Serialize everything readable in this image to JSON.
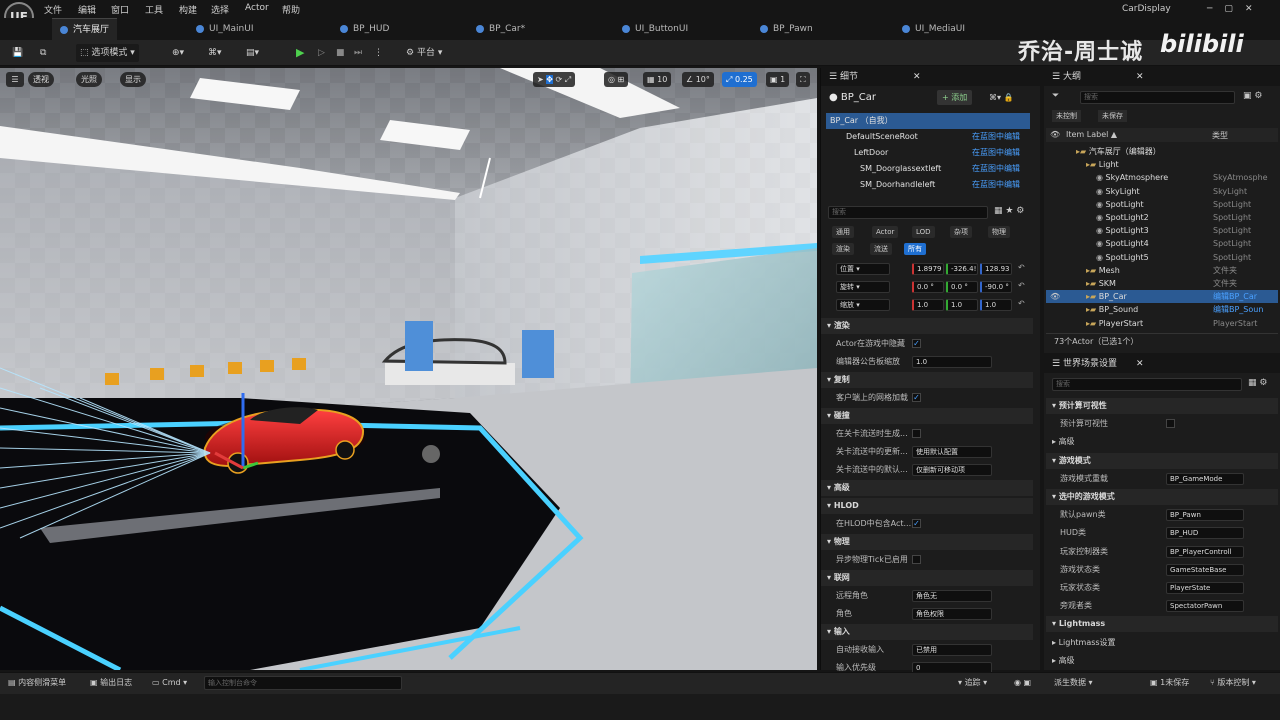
{
  "app": {
    "logo": "UE",
    "project": "CarDisplay"
  },
  "menu": [
    "文件",
    "编辑",
    "窗口",
    "工具",
    "构建",
    "选择",
    "Actor",
    "帮助"
  ],
  "tabs": [
    {
      "label": "汽车展厅",
      "active": true
    },
    {
      "label": "UI_MainUI"
    },
    {
      "label": "BP_HUD"
    },
    {
      "label": "BP_Car*"
    },
    {
      "label": "UI_ButtonUI"
    },
    {
      "label": "BP_Pawn"
    },
    {
      "label": "UI_MediaUI"
    }
  ],
  "window_controls": [
    "─",
    "▢",
    "✕"
  ],
  "watermark": {
    "name": "乔治-周士诚",
    "brand": "bilibili"
  },
  "toolbar": {
    "mode": "选项模式",
    "platform": "平台",
    "play": "▶",
    "step": "▷",
    "stop": "■",
    "skip": "⏭"
  },
  "viewport": {
    "perspective": "透视",
    "lit": "光照",
    "show": "显示",
    "grid": "10",
    "angle": "10°",
    "scale": "0.25",
    "cams": "1"
  },
  "details": {
    "title": "细节",
    "actor": "BP_Car",
    "add": "+ 添加",
    "tree": [
      {
        "label": "BP_Car （自我）",
        "sel": true
      },
      {
        "label": "DefaultSceneRoot",
        "link": "在蓝图中编辑"
      },
      {
        "label": "LeftDoor",
        "link": "在蓝图中编辑"
      },
      {
        "label": "SM_Doorglassextleft",
        "link": "在蓝图中编辑"
      },
      {
        "label": "SM_Doorhandleleft",
        "link": "在蓝图中编辑"
      }
    ],
    "search_placeholder": "搜索",
    "filters": [
      "通用",
      "Actor",
      "LOD",
      "杂项",
      "物理",
      "渲染",
      "流送",
      "所有"
    ],
    "transform": [
      {
        "label": "位置",
        "v": [
          "1.8979",
          "-326.4!",
          "128.93"
        ]
      },
      {
        "label": "旋转",
        "v": [
          "0.0 °",
          "0.0 °",
          "-90.0 °"
        ]
      },
      {
        "label": "缩放",
        "v": [
          "1.0",
          "1.0",
          "1.0"
        ]
      }
    ],
    "sections": {
      "render": "渲染",
      "hidden": "Actor在游戏中隐藏",
      "billboard": "编辑器公告板缩放",
      "billboard_v": "1.0",
      "replication": "复制",
      "net_load": "客户端上的网格加载",
      "collision": "碰撞",
      "gen": "在关卡流送时生成...",
      "update": "关卡流送中的更新...",
      "update_v": "使用默认配置",
      "default": "关卡流送中的默认...",
      "default_v": "仅删新可移动项",
      "advanced": "高级",
      "hlod": "HLOD",
      "hlod_inc": "在HLOD中包含Act...",
      "physics": "物理",
      "async": "异步物理Tick已启用",
      "network": "联网",
      "remote": "远程角色",
      "remote_v": "角色无",
      "role": "角色",
      "role_v": "角色权限",
      "input": "输入",
      "auto": "自动接收输入",
      "auto_v": "已禁用",
      "priority": "输入优先级",
      "priority_v": "0"
    }
  },
  "outliner": {
    "title": "大纲",
    "search_placeholder": "搜索",
    "unsaved": "未控制",
    "unsaved2": "未保存",
    "col1": "Item Label ▲",
    "col2": "类型",
    "items": [
      {
        "l": "汽车展厅（编辑器）",
        "t": "",
        "d": 1
      },
      {
        "l": "Light",
        "t": "",
        "d": 2
      },
      {
        "l": "SkyAtmosphere",
        "t": "SkyAtmosphe",
        "d": 3
      },
      {
        "l": "SkyLight",
        "t": "SkyLight",
        "d": 3
      },
      {
        "l": "SpotLight",
        "t": "SpotLight",
        "d": 3
      },
      {
        "l": "SpotLight2",
        "t": "SpotLight",
        "d": 3
      },
      {
        "l": "SpotLight3",
        "t": "SpotLight",
        "d": 3
      },
      {
        "l": "SpotLight4",
        "t": "SpotLight",
        "d": 3
      },
      {
        "l": "SpotLight5",
        "t": "SpotLight",
        "d": 3
      },
      {
        "l": "Mesh",
        "t": "文件夹",
        "d": 2
      },
      {
        "l": "SKM",
        "t": "文件夹",
        "d": 2
      },
      {
        "l": "BP_Car",
        "t": "编辑BP_Car",
        "d": 2,
        "sel": true
      },
      {
        "l": "BP_Sound",
        "t": "编辑BP_Soun",
        "d": 2
      },
      {
        "l": "PlayerStart",
        "t": "PlayerStart",
        "d": 2
      }
    ],
    "count": "73个Actor（已选1个）"
  },
  "world": {
    "title": "世界场景设置",
    "search_placeholder": "搜索",
    "rows": [
      {
        "l": "预计算可视性",
        "s": true
      },
      {
        "l": "预计算可视性",
        "c": true
      },
      {
        "l": "高级",
        "s2": true
      },
      {
        "l": "游戏模式",
        "s": true
      },
      {
        "l": "游戏模式重载",
        "v": "BP_GameMode"
      },
      {
        "l": "选中的游戏模式",
        "s": true
      },
      {
        "l": "默认pawn类",
        "v": "BP_Pawn"
      },
      {
        "l": "HUD类",
        "v": "BP_HUD"
      },
      {
        "l": "玩家控制器类",
        "v": "BP_PlayerControll"
      },
      {
        "l": "游戏状态类",
        "v": "GameStateBase"
      },
      {
        "l": "玩家状态类",
        "v": "PlayerState"
      },
      {
        "l": "旁观者类",
        "v": "SpectatorPawn"
      },
      {
        "l": "Lightmass",
        "s": true
      },
      {
        "l": "Lightmass设置",
        "s2": true
      },
      {
        "l": "高级",
        "s2": true
      }
    ]
  },
  "status": {
    "drawer": "内容侧滑菜单",
    "log": "输出日志",
    "cmd": "Cmd",
    "cmd_placeholder": "输入控制台命令",
    "trace": "追踪",
    "derived": "派生数据",
    "save": "1未保存",
    "vc": "版本控制"
  }
}
